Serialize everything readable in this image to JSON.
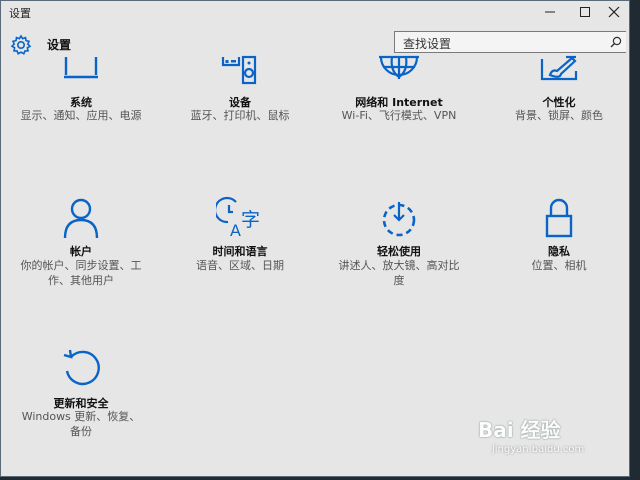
{
  "window": {
    "title": "设置"
  },
  "header": {
    "app_name": "设置"
  },
  "search": {
    "placeholder": "查找设置"
  },
  "tiles": [
    {
      "name": "系统",
      "desc": "显示、通知、应用、电源",
      "icon": "monitor-icon"
    },
    {
      "name": "设备",
      "desc": "蓝牙、打印机、鼠标",
      "icon": "devices-icon"
    },
    {
      "name": "网络和 Internet",
      "desc": "Wi-Fi、飞行模式、VPN",
      "icon": "globe-icon"
    },
    {
      "name": "个性化",
      "desc": "背景、锁屏、颜色",
      "icon": "paint-icon"
    },
    {
      "name": "帐户",
      "desc": "你的帐户、同步设置、工作、其他用户",
      "icon": "person-icon"
    },
    {
      "name": "时间和语言",
      "desc": "语音、区域、日期",
      "icon": "time-language-icon"
    },
    {
      "name": "轻松使用",
      "desc": "讲述人、放大镜、高对比度",
      "icon": "ease-of-access-icon"
    },
    {
      "name": "隐私",
      "desc": "位置、相机",
      "icon": "lock-icon"
    },
    {
      "name": "更新和安全",
      "desc": "Windows 更新、恢复、备份",
      "icon": "update-icon"
    }
  ],
  "watermark": {
    "main": "Bai 经验",
    "sub": "jingyan.baidu.com"
  },
  "colors": {
    "accent": "#0a64c8",
    "background": "#e6e6e6"
  }
}
